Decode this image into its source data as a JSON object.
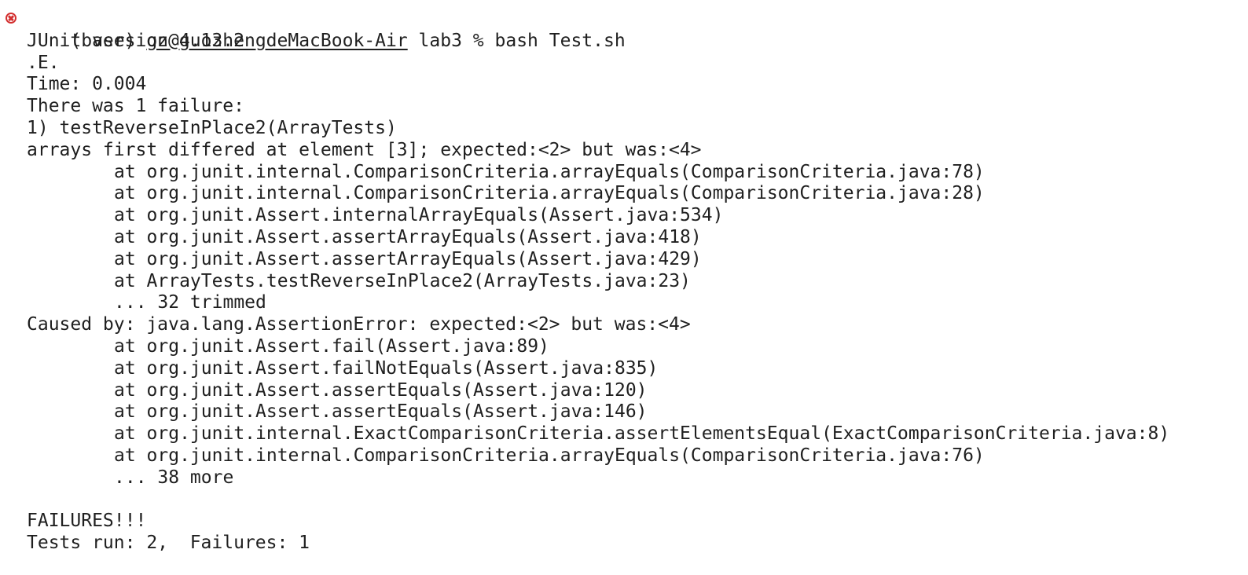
{
  "prompt": {
    "env": "(base)",
    "host": "gz@guozhengdeMacBook-Air",
    "cwd": "lab3",
    "symbol": "%",
    "command": "bash Test.sh"
  },
  "output": {
    "junit_version": "JUnit version 4.13.2",
    "progress": ".E.",
    "time": "Time: 0.004",
    "failure_summary": "There was 1 failure:",
    "failure_title": "1) testReverseInPlace2(ArrayTests)",
    "failure_message": "arrays first differed at element [3]; expected:<2> but was:<4>",
    "stack1": [
      "at org.junit.internal.ComparisonCriteria.arrayEquals(ComparisonCriteria.java:78)",
      "at org.junit.internal.ComparisonCriteria.arrayEquals(ComparisonCriteria.java:28)",
      "at org.junit.Assert.internalArrayEquals(Assert.java:534)",
      "at org.junit.Assert.assertArrayEquals(Assert.java:418)",
      "at org.junit.Assert.assertArrayEquals(Assert.java:429)",
      "at ArrayTests.testReverseInPlace2(ArrayTests.java:23)",
      "... 32 trimmed"
    ],
    "caused_by": "Caused by: java.lang.AssertionError: expected:<2> but was:<4>",
    "stack2": [
      "at org.junit.Assert.fail(Assert.java:89)",
      "at org.junit.Assert.failNotEquals(Assert.java:835)",
      "at org.junit.Assert.assertEquals(Assert.java:120)",
      "at org.junit.Assert.assertEquals(Assert.java:146)",
      "at org.junit.internal.ExactComparisonCriteria.assertElementsEqual(ExactComparisonCriteria.java:8)",
      "at org.junit.internal.ComparisonCriteria.arrayEquals(ComparisonCriteria.java:76)",
      "... 38 more"
    ],
    "failures_banner": "FAILURES!!!",
    "result_summary": "Tests run: 2,  Failures: 1"
  },
  "colors": {
    "background": "#ffffff",
    "text": "#1f1f1f",
    "error_icon": "#d32f2f"
  },
  "icons": {
    "status": "error-circle-x-icon"
  }
}
